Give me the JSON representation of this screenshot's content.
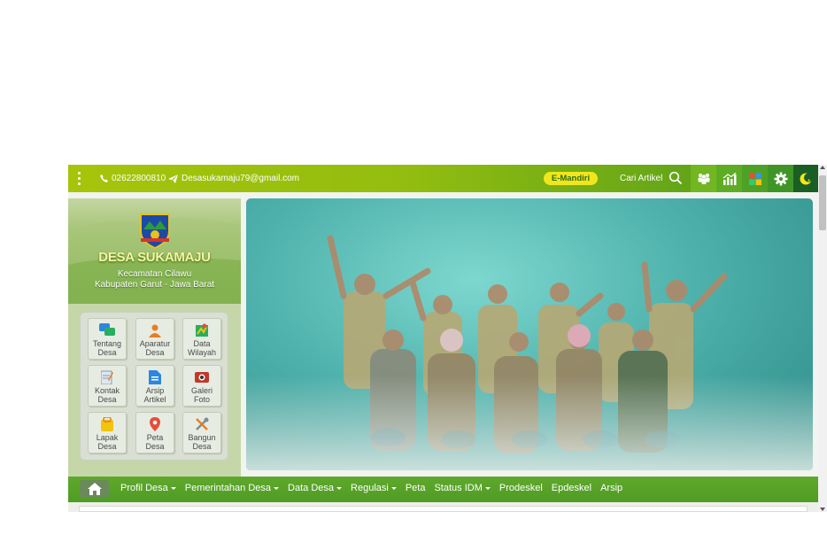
{
  "topbar": {
    "phone": "02622800810",
    "email": "Desasukamaju79@gmail.com",
    "emandiri_label": "E-Mandiri",
    "search_label": "Cari Artikel",
    "icons": [
      "menu-dots-icon",
      "phone-icon",
      "send-icon",
      "search-icon",
      "people-icon",
      "statistics-icon",
      "grid-icon",
      "gear-icon",
      "moon-icon"
    ]
  },
  "brand": {
    "name": "DESA SUKAMAJU",
    "kecamatan": "Kecamatan Cilawu",
    "kabupaten": "Kabupaten Garut - Jawa Barat"
  },
  "menu": [
    {
      "line1": "Tentang",
      "line2": "Desa",
      "icon": "chat-icon"
    },
    {
      "line1": "Aparatur",
      "line2": "Desa",
      "icon": "person-icon"
    },
    {
      "line1": "Data",
      "line2": "Wilayah",
      "icon": "map-icon"
    },
    {
      "line1": "Kontak",
      "line2": "Desa",
      "icon": "note-icon"
    },
    {
      "line1": "Arsip",
      "line2": "Artikel",
      "icon": "document-icon"
    },
    {
      "line1": "Galeri",
      "line2": "Foto",
      "icon": "camera-icon"
    },
    {
      "line1": "Lapak",
      "line2": "Desa",
      "icon": "shop-icon"
    },
    {
      "line1": "Peta",
      "line2": "Desa",
      "icon": "map-pin-icon"
    },
    {
      "line1": "Bangun",
      "line2": "Desa",
      "icon": "tools-icon"
    }
  ],
  "nav": {
    "items": [
      {
        "label": "Profil Desa",
        "dropdown": true
      },
      {
        "label": "Pemerintahan Desa",
        "dropdown": true
      },
      {
        "label": "Data Desa",
        "dropdown": true
      },
      {
        "label": "Regulasi",
        "dropdown": true
      },
      {
        "label": "Peta",
        "dropdown": false
      },
      {
        "label": "Status IDM",
        "dropdown": true
      },
      {
        "label": "Prodeskel",
        "dropdown": false
      },
      {
        "label": "Epdeskel",
        "dropdown": false
      },
      {
        "label": "Arsip",
        "dropdown": false
      }
    ]
  },
  "colors": {
    "accent": "#93bd10",
    "emandiri": "#f1e61d",
    "nav": "#5fa82b",
    "dark": "#1a5e24"
  }
}
